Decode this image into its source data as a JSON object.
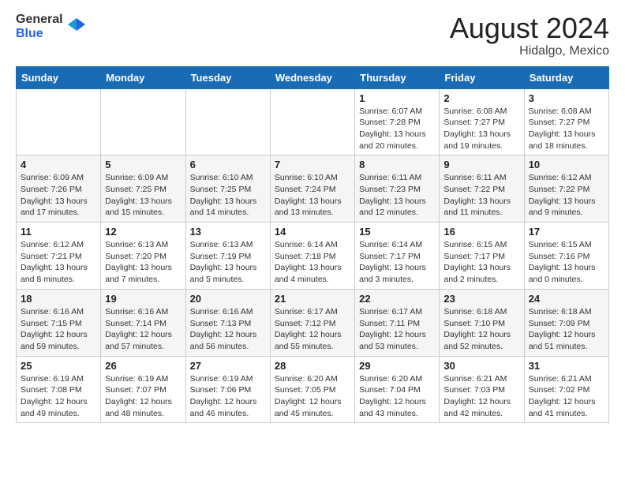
{
  "header": {
    "logo_general": "General",
    "logo_blue": "Blue",
    "month_year": "August 2024",
    "location": "Hidalgo, Mexico"
  },
  "weekdays": [
    "Sunday",
    "Monday",
    "Tuesday",
    "Wednesday",
    "Thursday",
    "Friday",
    "Saturday"
  ],
  "weeks": [
    [
      {
        "day": "",
        "info": ""
      },
      {
        "day": "",
        "info": ""
      },
      {
        "day": "",
        "info": ""
      },
      {
        "day": "",
        "info": ""
      },
      {
        "day": "1",
        "info": "Sunrise: 6:07 AM\nSunset: 7:28 PM\nDaylight: 13 hours\nand 20 minutes."
      },
      {
        "day": "2",
        "info": "Sunrise: 6:08 AM\nSunset: 7:27 PM\nDaylight: 13 hours\nand 19 minutes."
      },
      {
        "day": "3",
        "info": "Sunrise: 6:08 AM\nSunset: 7:27 PM\nDaylight: 13 hours\nand 18 minutes."
      }
    ],
    [
      {
        "day": "4",
        "info": "Sunrise: 6:09 AM\nSunset: 7:26 PM\nDaylight: 13 hours\nand 17 minutes."
      },
      {
        "day": "5",
        "info": "Sunrise: 6:09 AM\nSunset: 7:25 PM\nDaylight: 13 hours\nand 15 minutes."
      },
      {
        "day": "6",
        "info": "Sunrise: 6:10 AM\nSunset: 7:25 PM\nDaylight: 13 hours\nand 14 minutes."
      },
      {
        "day": "7",
        "info": "Sunrise: 6:10 AM\nSunset: 7:24 PM\nDaylight: 13 hours\nand 13 minutes."
      },
      {
        "day": "8",
        "info": "Sunrise: 6:11 AM\nSunset: 7:23 PM\nDaylight: 13 hours\nand 12 minutes."
      },
      {
        "day": "9",
        "info": "Sunrise: 6:11 AM\nSunset: 7:22 PM\nDaylight: 13 hours\nand 11 minutes."
      },
      {
        "day": "10",
        "info": "Sunrise: 6:12 AM\nSunset: 7:22 PM\nDaylight: 13 hours\nand 9 minutes."
      }
    ],
    [
      {
        "day": "11",
        "info": "Sunrise: 6:12 AM\nSunset: 7:21 PM\nDaylight: 13 hours\nand 8 minutes."
      },
      {
        "day": "12",
        "info": "Sunrise: 6:13 AM\nSunset: 7:20 PM\nDaylight: 13 hours\nand 7 minutes."
      },
      {
        "day": "13",
        "info": "Sunrise: 6:13 AM\nSunset: 7:19 PM\nDaylight: 13 hours\nand 5 minutes."
      },
      {
        "day": "14",
        "info": "Sunrise: 6:14 AM\nSunset: 7:18 PM\nDaylight: 13 hours\nand 4 minutes."
      },
      {
        "day": "15",
        "info": "Sunrise: 6:14 AM\nSunset: 7:17 PM\nDaylight: 13 hours\nand 3 minutes."
      },
      {
        "day": "16",
        "info": "Sunrise: 6:15 AM\nSunset: 7:17 PM\nDaylight: 13 hours\nand 2 minutes."
      },
      {
        "day": "17",
        "info": "Sunrise: 6:15 AM\nSunset: 7:16 PM\nDaylight: 13 hours\nand 0 minutes."
      }
    ],
    [
      {
        "day": "18",
        "info": "Sunrise: 6:16 AM\nSunset: 7:15 PM\nDaylight: 12 hours\nand 59 minutes."
      },
      {
        "day": "19",
        "info": "Sunrise: 6:16 AM\nSunset: 7:14 PM\nDaylight: 12 hours\nand 57 minutes."
      },
      {
        "day": "20",
        "info": "Sunrise: 6:16 AM\nSunset: 7:13 PM\nDaylight: 12 hours\nand 56 minutes."
      },
      {
        "day": "21",
        "info": "Sunrise: 6:17 AM\nSunset: 7:12 PM\nDaylight: 12 hours\nand 55 minutes."
      },
      {
        "day": "22",
        "info": "Sunrise: 6:17 AM\nSunset: 7:11 PM\nDaylight: 12 hours\nand 53 minutes."
      },
      {
        "day": "23",
        "info": "Sunrise: 6:18 AM\nSunset: 7:10 PM\nDaylight: 12 hours\nand 52 minutes."
      },
      {
        "day": "24",
        "info": "Sunrise: 6:18 AM\nSunset: 7:09 PM\nDaylight: 12 hours\nand 51 minutes."
      }
    ],
    [
      {
        "day": "25",
        "info": "Sunrise: 6:19 AM\nSunset: 7:08 PM\nDaylight: 12 hours\nand 49 minutes."
      },
      {
        "day": "26",
        "info": "Sunrise: 6:19 AM\nSunset: 7:07 PM\nDaylight: 12 hours\nand 48 minutes."
      },
      {
        "day": "27",
        "info": "Sunrise: 6:19 AM\nSunset: 7:06 PM\nDaylight: 12 hours\nand 46 minutes."
      },
      {
        "day": "28",
        "info": "Sunrise: 6:20 AM\nSunset: 7:05 PM\nDaylight: 12 hours\nand 45 minutes."
      },
      {
        "day": "29",
        "info": "Sunrise: 6:20 AM\nSunset: 7:04 PM\nDaylight: 12 hours\nand 43 minutes."
      },
      {
        "day": "30",
        "info": "Sunrise: 6:21 AM\nSunset: 7:03 PM\nDaylight: 12 hours\nand 42 minutes."
      },
      {
        "day": "31",
        "info": "Sunrise: 6:21 AM\nSunset: 7:02 PM\nDaylight: 12 hours\nand 41 minutes."
      }
    ]
  ]
}
